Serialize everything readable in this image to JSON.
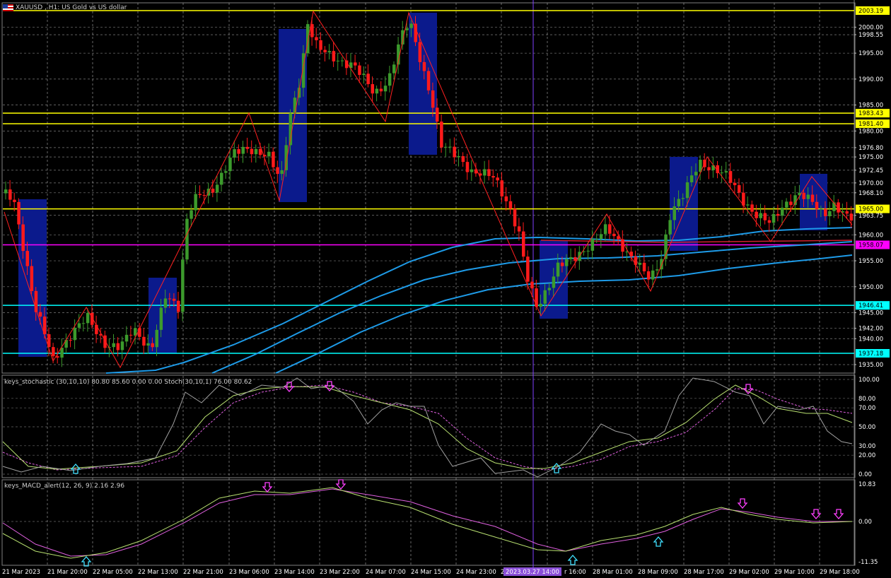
{
  "header": {
    "symbol_title": "XAUUSD , H1: US Gold vs US dollar"
  },
  "indicators": {
    "stoch_label": "keys_stochastic (30,10,10) 80.80 85.60 0.00 0.00 Stoch(30,10,1) 76.00 80.62",
    "macd_label": "keys_MACD_alert(12, 26, 9) 2.16 2.96"
  },
  "price_axis": {
    "ticks": [
      "2000.00",
      "1998.55",
      "1995.00",
      "1990.00",
      "1985.00",
      "1980.00",
      "1976.80",
      "1975.00",
      "1972.45",
      "1970.00",
      "1968.10",
      "1963.75",
      "1960.00",
      "1955.00",
      "1950.00",
      "1945.00",
      "1942.00",
      "1940.00",
      "1935.00"
    ],
    "badges": [
      {
        "label": "2003.19",
        "price": 2003.19,
        "color": "#ffff00"
      },
      {
        "label": "1983.43",
        "price": 1983.43,
        "color": "#ffff00"
      },
      {
        "label": "1981.40",
        "price": 1981.4,
        "color": "#ffff00"
      },
      {
        "label": "1965.00",
        "price": 1965.0,
        "color": "#ffff00"
      },
      {
        "label": "1958.07",
        "price": 1958.07,
        "color": "#ff00ff"
      },
      {
        "label": "1946.41",
        "price": 1946.41,
        "color": "#00ffff"
      },
      {
        "label": "1937.18",
        "price": 1937.18,
        "color": "#00ffff"
      }
    ]
  },
  "stoch_axis": {
    "ticks": [
      "100.00",
      "80.00",
      "70.00",
      "50.00",
      "30.00",
      "20.00",
      "0.00"
    ]
  },
  "macd_axis": {
    "ticks": [
      "10.83",
      "0.00",
      "-11.35"
    ]
  },
  "time_axis": {
    "labels": [
      "21 Mar 2023",
      "21 Mar 20:00",
      "22 Mar 05:00",
      "22 Mar 13:00",
      "22 Mar 21:00",
      "23 Mar 06:00",
      "23 Mar 14:00",
      "23 Mar 22:00",
      "24 Mar 07:00",
      "24 Mar 15:00",
      "24 Mar 23:00",
      "27",
      "2023.03.27 14:00",
      "r 16:00",
      "28 Mar 01:00",
      "28 Mar 09:00",
      "28 Mar 17:00",
      "29 Mar 02:00",
      "29 Mar 10:00",
      "29 Mar 18:00"
    ]
  },
  "colors": {
    "bull": "#3c9a2c",
    "bear": "#ff1a1a",
    "grid": "#d0d0d0",
    "ma": "#1e9be8",
    "zone": "#0b1a8c",
    "zigzag": "#ff2020",
    "crosshair": "#8040ff"
  }
}
